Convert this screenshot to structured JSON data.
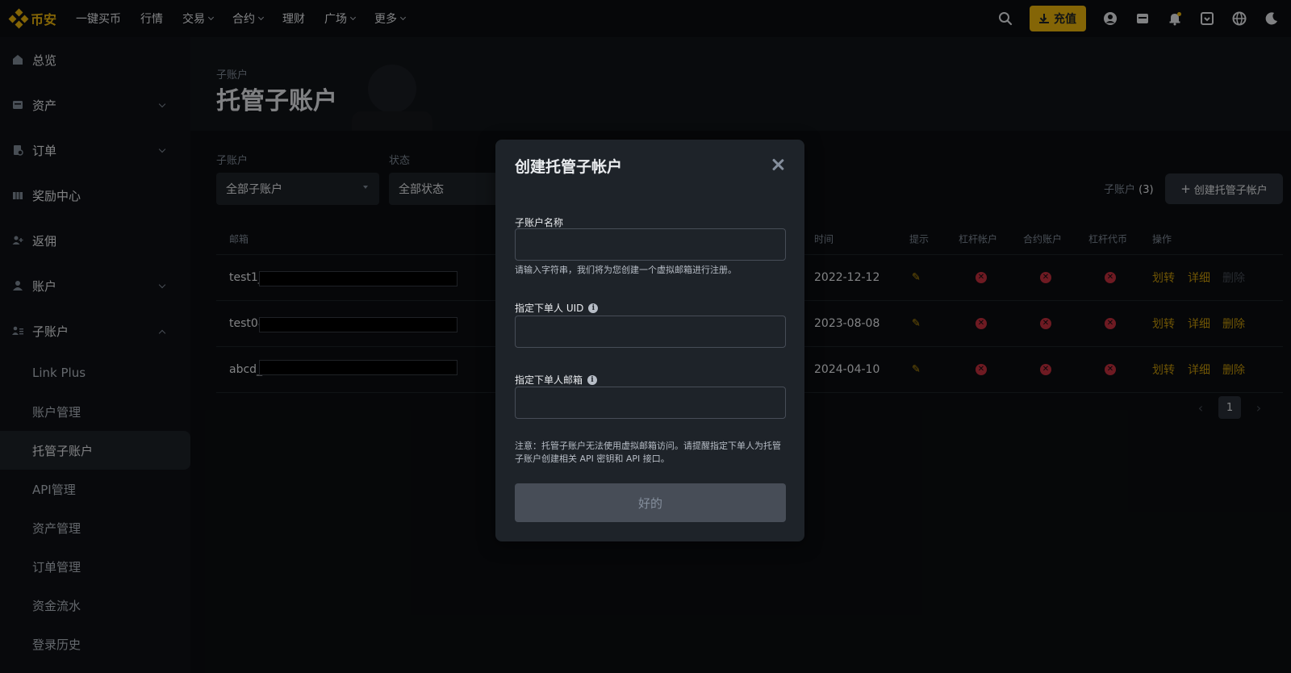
{
  "topbar": {
    "logo_text": "币安",
    "nav": [
      {
        "label": "一键买币",
        "has_menu": false
      },
      {
        "label": "行情",
        "has_menu": false
      },
      {
        "label": "交易",
        "has_menu": true
      },
      {
        "label": "合约",
        "has_menu": true
      },
      {
        "label": "理财",
        "has_menu": false
      },
      {
        "label": "广场",
        "has_menu": true
      },
      {
        "label": "更多",
        "has_menu": true
      }
    ],
    "deposit_label": "充值"
  },
  "sidebar": {
    "items": [
      {
        "label": "总览",
        "icon": "home-icon"
      },
      {
        "label": "资产",
        "icon": "wallet-icon"
      },
      {
        "label": "订单",
        "icon": "orders-icon"
      },
      {
        "label": "奖励中心",
        "icon": "reward-icon"
      },
      {
        "label": "返佣",
        "icon": "referral-icon"
      },
      {
        "label": "账户",
        "icon": "user-icon"
      },
      {
        "label": "子账户",
        "icon": "sub-account-icon"
      }
    ],
    "sub_items": [
      "Link Plus",
      "账户管理",
      "托管子账户",
      "API管理",
      "资产管理",
      "订单管理",
      "资金流水",
      "登录历史"
    ],
    "active_sub": "托管子账户"
  },
  "hero": {
    "breadcrumb": "子账户",
    "title": "托管子账户"
  },
  "filters": {
    "sub_label": "子账户",
    "sub_value": "全部子账户",
    "status_label": "状态",
    "status_value": "全部状态"
  },
  "summary": {
    "count_label": "子账户",
    "count_value": "(3)",
    "create_label": "创建托管子帐户"
  },
  "table": {
    "headers": {
      "email": "邮箱",
      "time": "时间",
      "hint": "提示",
      "margin": "杠杆帐户",
      "futures": "合约账户",
      "leverage_token": "杠杆代币",
      "actions": "操作"
    },
    "rows": [
      {
        "email": "test1_",
        "time": "2022-12-12",
        "transfer": "划转",
        "detail": "详细",
        "delete": "删除",
        "delete_enabled": false
      },
      {
        "email": "test08",
        "time": "2023-08-08",
        "transfer": "划转",
        "detail": "详细",
        "delete": "删除",
        "delete_enabled": true
      },
      {
        "email": "abcd_",
        "time": "2024-04-10",
        "transfer": "划转",
        "detail": "详细",
        "delete": "删除",
        "delete_enabled": true
      }
    ]
  },
  "pager": {
    "current": "1"
  },
  "modal": {
    "title": "创建托管子帐户",
    "name_label": "子账户名称",
    "name_value": "",
    "name_hint": "请输入字符串，我们将为您创建一个虚拟邮箱进行注册。",
    "uid_label": "指定下单人 UID",
    "uid_value": "",
    "email_label": "指定下单人邮箱",
    "email_value": "",
    "note": "注意：托管子账户无法使用虚拟邮箱访问。请提醒指定下单人为托管子账户创建相关 API 密钥和 API 接口。",
    "ok_label": "好的"
  },
  "colors": {
    "accent": "#f0b90b",
    "background": "#0b0e11",
    "panel": "#1e2329",
    "danger": "#c8303f"
  }
}
